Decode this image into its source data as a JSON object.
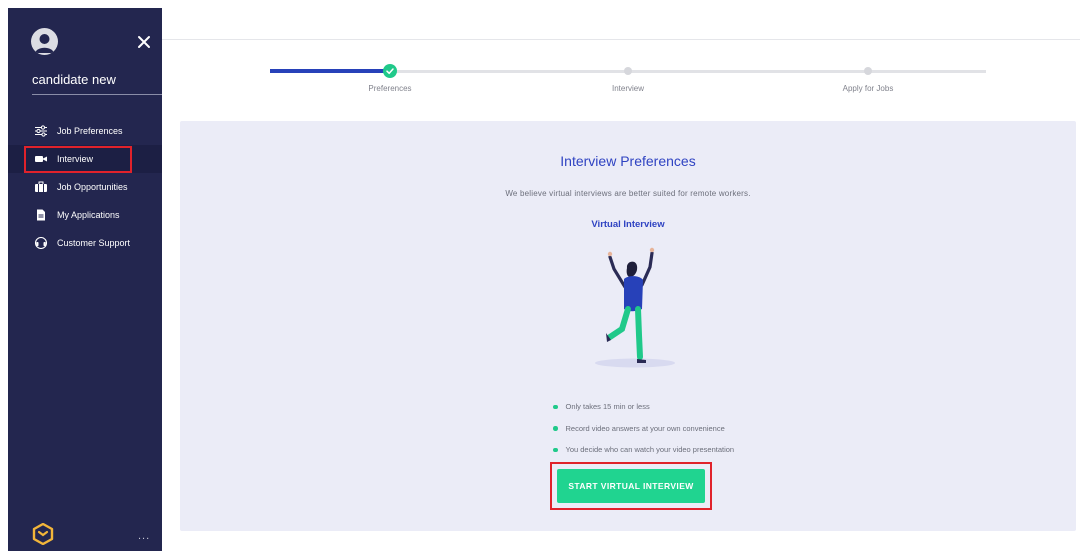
{
  "user": {
    "name": "candidate new"
  },
  "sidebar": {
    "items": [
      {
        "label": "Job Preferences",
        "icon": "sliders-icon"
      },
      {
        "label": "Interview",
        "icon": "video-camera-icon",
        "active": true
      },
      {
        "label": "Job Opportunities",
        "icon": "briefcase-icon"
      },
      {
        "label": "My Applications",
        "icon": "document-icon"
      },
      {
        "label": "Customer Support",
        "icon": "headset-icon"
      }
    ],
    "more_label": "..."
  },
  "stepper": {
    "steps": [
      {
        "label": "Preferences",
        "state": "completed"
      },
      {
        "label": "Interview",
        "state": "pending"
      },
      {
        "label": "Apply for Jobs",
        "state": "pending"
      }
    ]
  },
  "card": {
    "title": "Interview Preferences",
    "subtitle": "We believe virtual interviews are better suited for remote workers.",
    "section_title": "Virtual Interview",
    "bullets": [
      "Only takes 15 min or less",
      "Record video answers at your own convenience",
      "You decide who can watch your video presentation"
    ],
    "cta_label": "START VIRTUAL INTERVIEW"
  },
  "colors": {
    "sidebar_bg": "#23264f",
    "accent_blue": "#2f43c2",
    "accent_green": "#20d490",
    "highlight_red": "#e0222b",
    "card_bg": "#ebecf7"
  }
}
